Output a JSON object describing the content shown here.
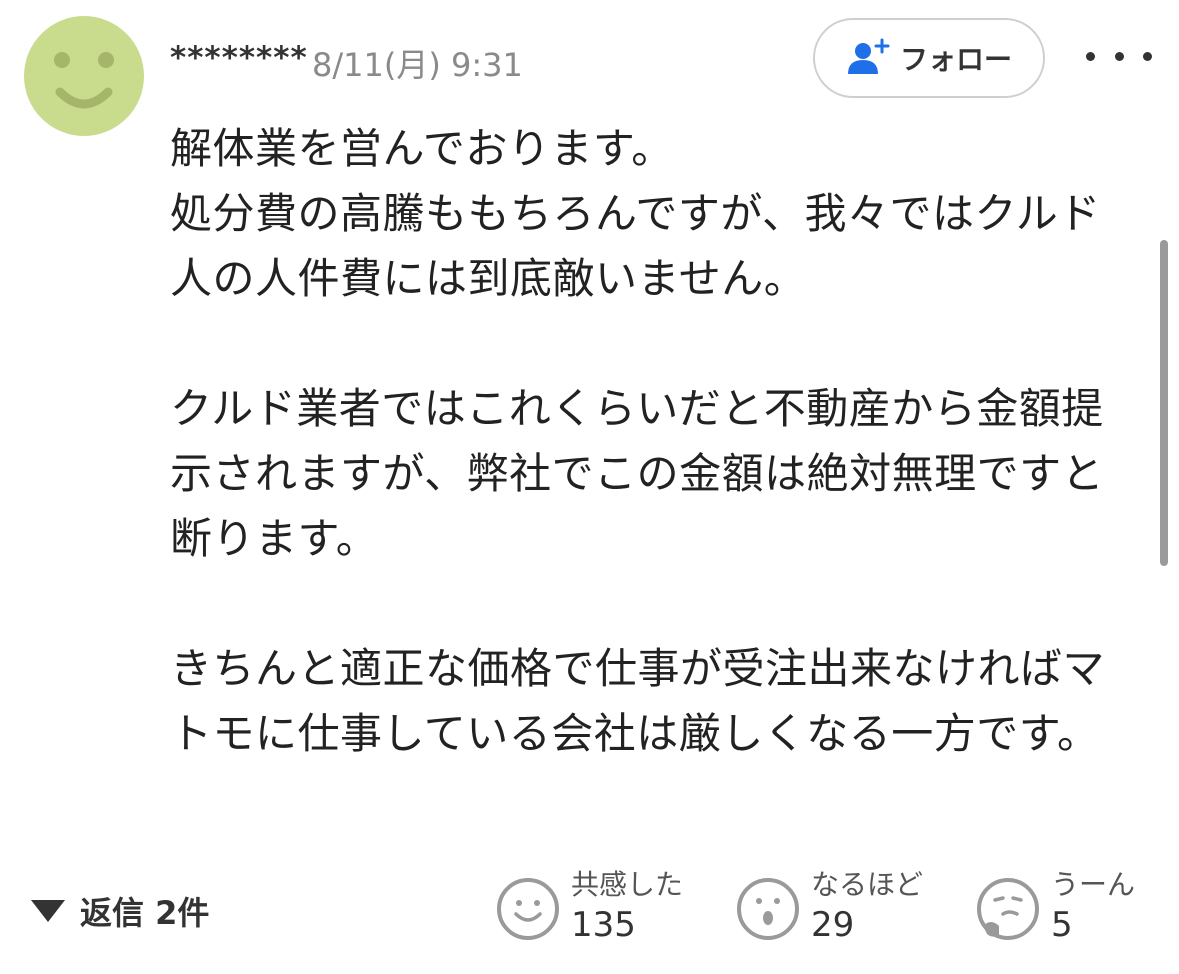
{
  "comment": {
    "author": "********",
    "timestamp": "8/11(月) 9:31",
    "follow_label": "フォロー",
    "paragraphs": [
      "解体業を営んでおります。\n処分費の高騰ももちろんですが、我々ではクルド人の人件費には到底敵いません。",
      "クルド業者ではこれくらいだと不動産から金額提示されますが、弊社でこの金額は絶対無理ですと断ります。",
      "きちんと適正な価格で仕事が受注出来なければマトモに仕事している会社は厳しくなる一方です。"
    ],
    "replies_label": "返信 2件",
    "reactions": [
      {
        "label": "共感した",
        "count": "135",
        "icon": "smile-face-icon"
      },
      {
        "label": "なるほど",
        "count": "29",
        "icon": "surprised-face-icon"
      },
      {
        "label": "うーん",
        "count": "5",
        "icon": "thinking-face-icon"
      }
    ]
  },
  "colors": {
    "avatar": "#c9db8d",
    "follow_icon": "#1e6fe8",
    "icon_gray": "#9a9a9a"
  }
}
